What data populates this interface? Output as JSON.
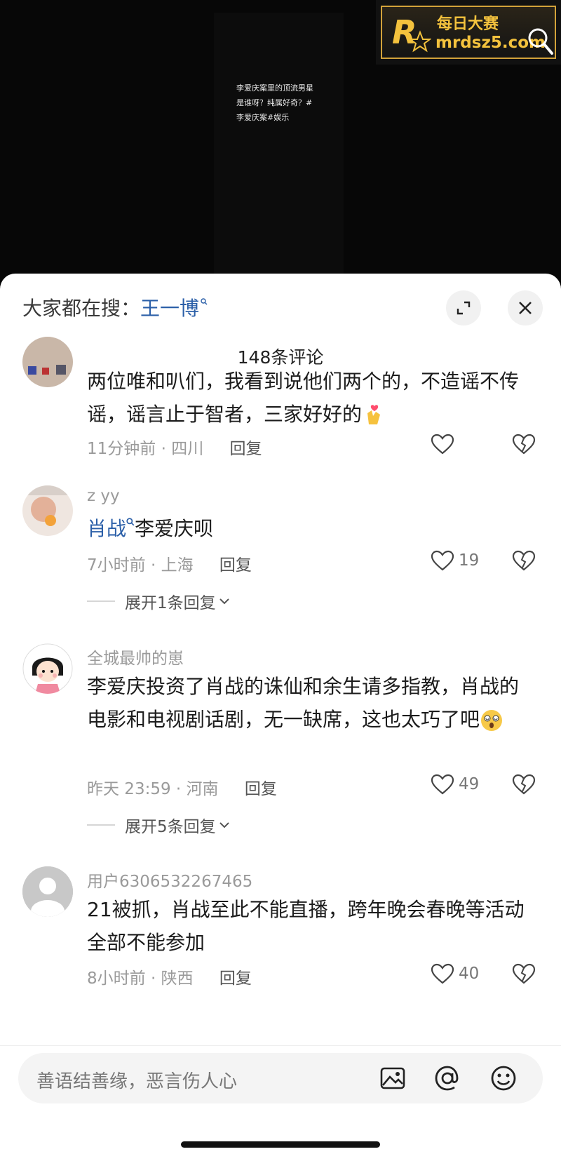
{
  "video": {
    "caption": "李爱庆案里的顶流男星\n是谁呀？纯属好奇？#\n李爱庆案#娱乐"
  },
  "watermark": {
    "title": "每日大赛",
    "domain": "mrdsz5.com",
    "logo_letter": "R"
  },
  "search": {
    "label": "大家都在搜：",
    "term": "王一博"
  },
  "header": {
    "comment_count": "148条评论"
  },
  "comments": [
    {
      "username": "",
      "text": "两位唯和叭们，我看到说他们两个的，不造谣不传谣，谣言止于智者，三家好好的",
      "emoji": "finger-heart-emoji",
      "time_location": "11分钟前 · 四川",
      "reply_label": "回复",
      "likes": "",
      "expand": ""
    },
    {
      "username": "z yy",
      "mention": "肖战",
      "text": "李爱庆呗",
      "time_location": "7小时前 · 上海",
      "reply_label": "回复",
      "likes": "19",
      "expand": "展开1条回复"
    },
    {
      "username": "全城最帅的崽",
      "text": "李爱庆投资了肖战的诛仙和余生请多指教，肖战的电影和电视剧话剧，无一缺席，这也太巧了吧",
      "emoji": "dizzy-face-emoji",
      "time_location": "昨天 23:59 · 河南",
      "reply_label": "回复",
      "likes": "49",
      "expand": "展开5条回复"
    },
    {
      "username": "用户6306532267465",
      "text": "21被抓，肖战至此不能直播，跨年晚会春晚等活动全部不能参加",
      "time_location": "8小时前 · 陕西",
      "reply_label": "回复",
      "likes": "40",
      "expand": ""
    }
  ],
  "input": {
    "placeholder": "善语结善缘，恶言伤人心"
  },
  "colors": {
    "mention_blue": "#2b5fa8",
    "meta_gray": "#9a9a9a",
    "watermark_gold": "#f4c23d"
  },
  "icons": [
    "expand-icon",
    "close-icon",
    "heart-icon",
    "broken-heart-icon",
    "image-icon",
    "at-icon",
    "emoji-icon",
    "search-icon"
  ]
}
